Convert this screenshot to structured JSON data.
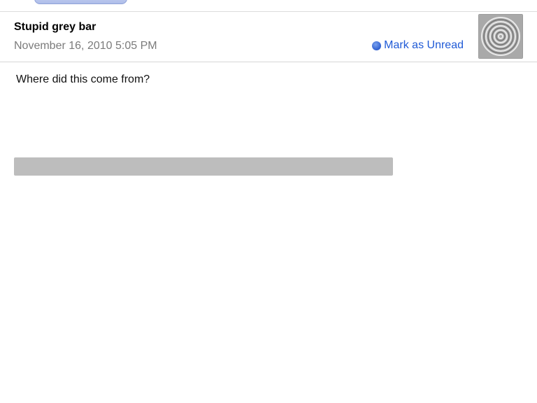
{
  "message": {
    "subject": "Stupid grey bar",
    "date": "November 16, 2010 5:05 PM",
    "mark_unread_label": "Mark as Unread",
    "body": "Where did this come from?"
  },
  "icons": {
    "unread_dot": "blue-dot-icon",
    "avatar": "swirl-pattern-avatar"
  },
  "colors": {
    "link": "#1f5ad6",
    "date": "#7b7b7b",
    "grey_bar": "#bdbdbd"
  }
}
